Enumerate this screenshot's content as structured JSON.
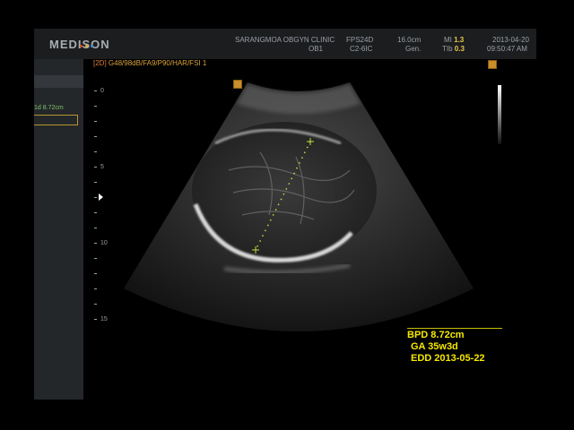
{
  "header": {
    "brand": "MEDISON",
    "clinic": "SARANGMOA OBGYN CLINIC",
    "preset": "OB1",
    "fps": "FPS24D",
    "probe": "C2-6IC",
    "depth": "16.0cm",
    "mode": "Gen.",
    "mi_label": "MI",
    "mi_value": "1.3",
    "tib_label": "TIb",
    "tib_value": "0.3",
    "date": "2013-04-20",
    "time": "09:50:47 AM"
  },
  "imaging": {
    "mode_tag": "[2D]",
    "params": "G48/98dB/FA9/P90/HAR/FSI 1"
  },
  "depth_scale": {
    "labels": [
      "0",
      "5",
      "10",
      "15"
    ]
  },
  "left_panel": {
    "measurement": "1d  8.72cm"
  },
  "results": {
    "bpd": "BPD 8.72cm",
    "ga": "GA 35w3d",
    "edd": "EDD 2013-05-22"
  },
  "colors": {
    "measurement_yellow": "#f5e800",
    "caliper_green": "#b8e23a",
    "param_orange": "#d9a23a"
  }
}
